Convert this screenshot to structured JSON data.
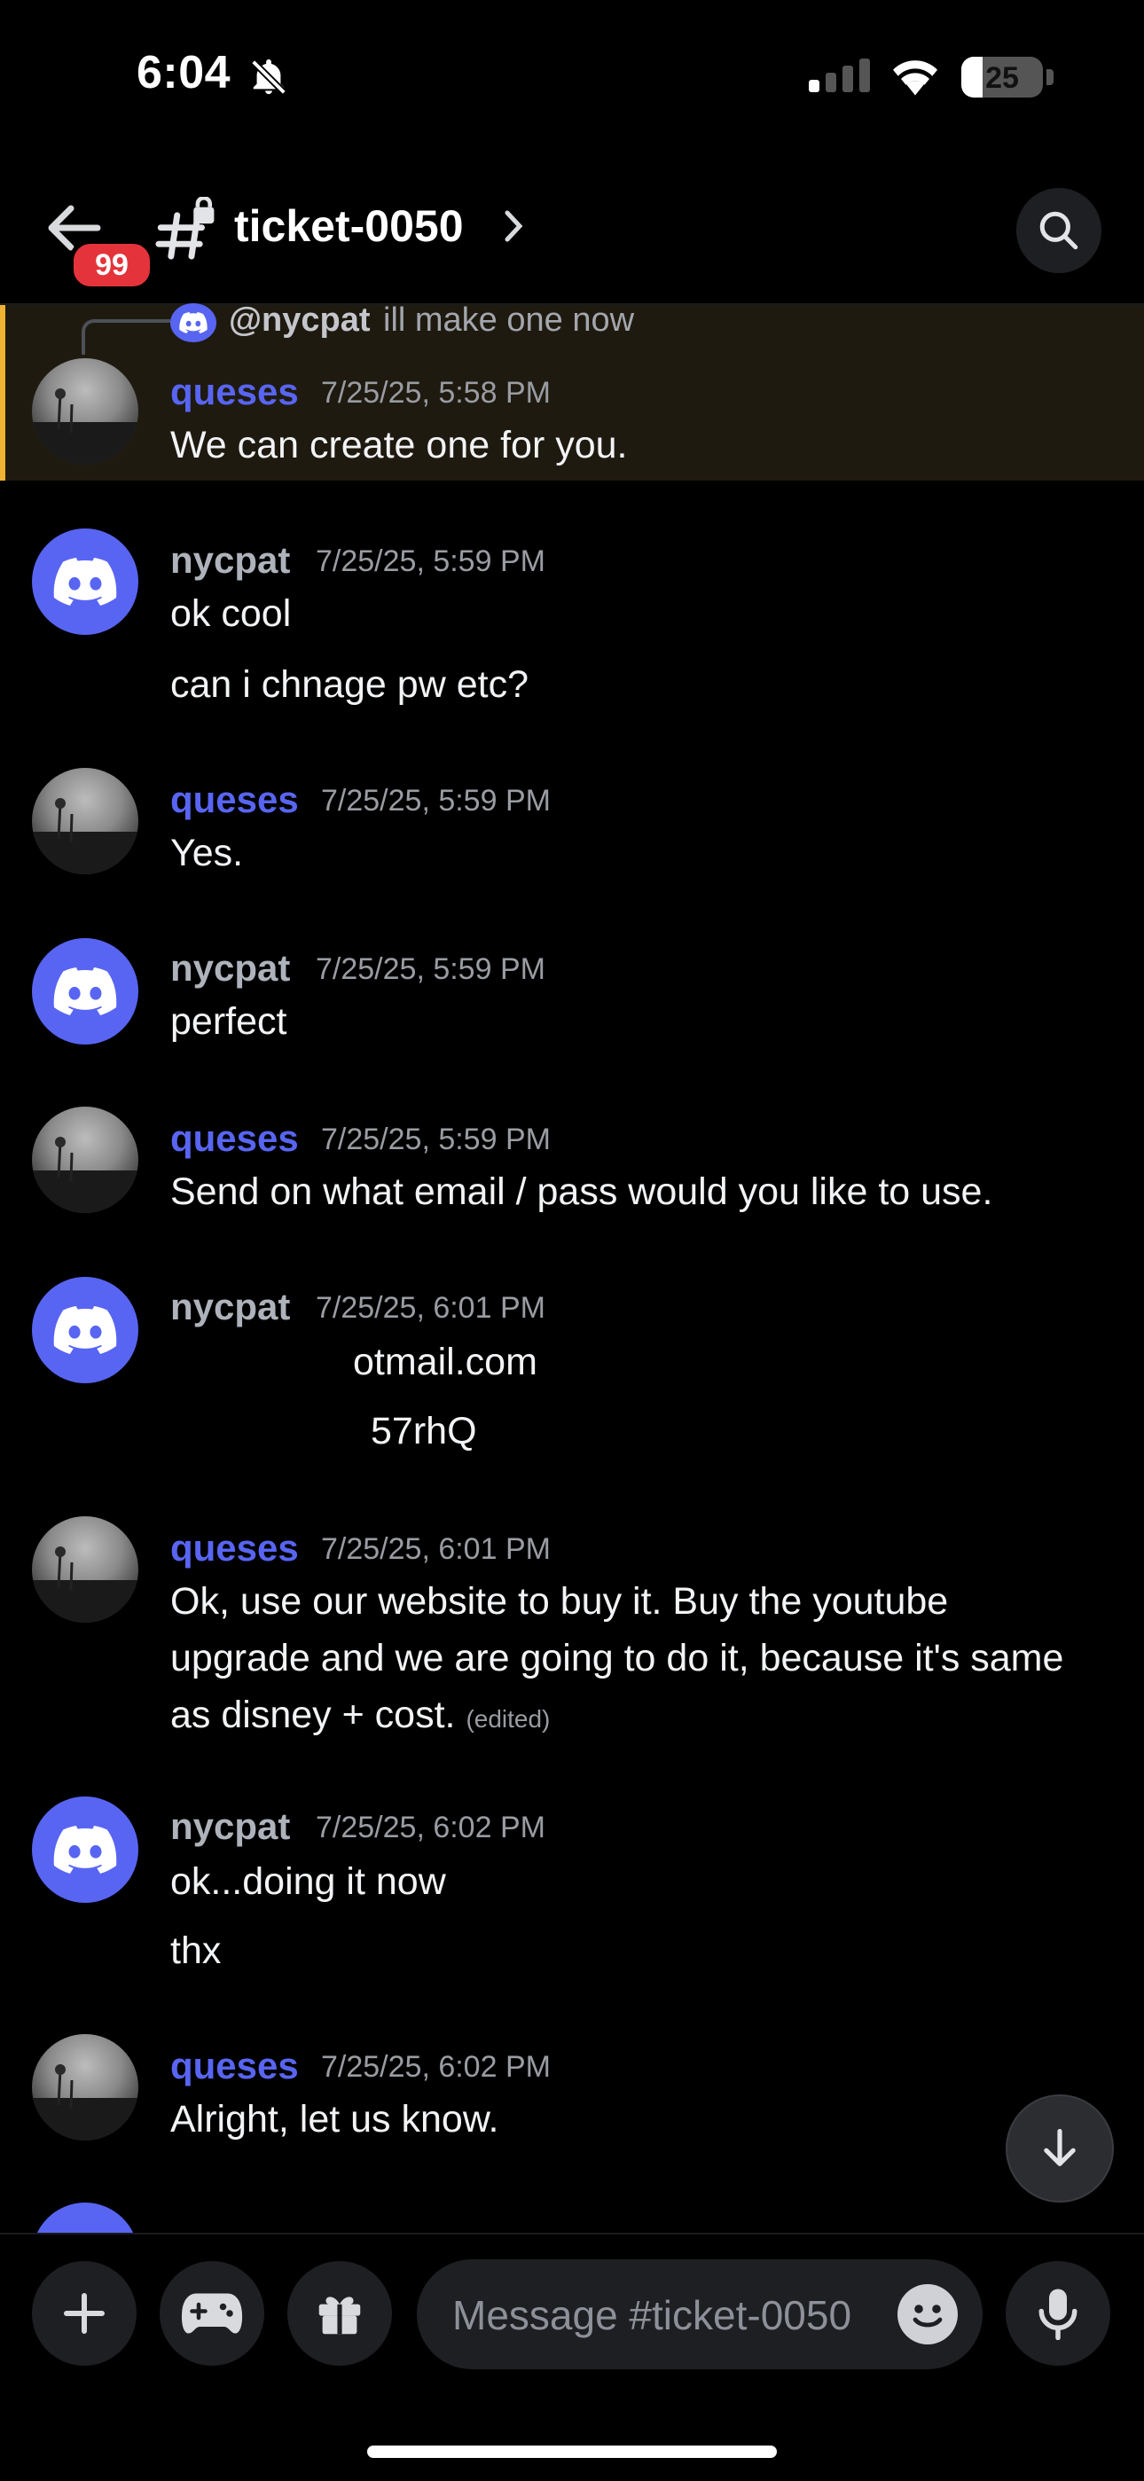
{
  "status_bar": {
    "time": "6:04",
    "battery": "25",
    "icons": [
      "bell-slash-icon",
      "signal-icon",
      "wifi-icon",
      "battery-icon"
    ]
  },
  "header": {
    "unread_badge": "99",
    "channel_name": "ticket-0050",
    "icons": [
      "back-arrow-icon",
      "hash-lock-icon",
      "chevron-right-icon",
      "search-icon"
    ]
  },
  "reply_preview": {
    "user": "@nycpat",
    "text": "ill make one now"
  },
  "messages": [
    {
      "user": "queses",
      "time": "7/25/25, 5:58 PM",
      "lines": [
        "We can create one for you."
      ]
    },
    {
      "user": "nycpat",
      "time": "7/25/25, 5:59 PM",
      "lines": [
        "ok cool",
        "can i chnage pw etc?"
      ]
    },
    {
      "user": "queses",
      "time": "7/25/25, 5:59 PM",
      "lines": [
        "Yes."
      ]
    },
    {
      "user": "nycpat",
      "time": "7/25/25, 5:59 PM",
      "lines": [
        "perfect"
      ]
    },
    {
      "user": "queses",
      "time": "7/25/25, 5:59 PM",
      "lines": [
        "Send on what email / pass would you like to use."
      ]
    },
    {
      "user": "nycpat",
      "time": "7/25/25, 6:01 PM",
      "lines": [
        "otmail.com",
        "57rhQ"
      ]
    },
    {
      "user": "queses",
      "time": "7/25/25, 6:01 PM",
      "lines": [
        "Ok, use our website to buy it. Buy the youtube",
        "upgrade and we are going to do it, because it's same",
        "as disney + cost."
      ],
      "edited": "(edited)"
    },
    {
      "user": "nycpat",
      "time": "7/25/25, 6:02 PM",
      "lines": [
        "ok...doing it now",
        "thx"
      ]
    },
    {
      "user": "queses",
      "time": "7/25/25, 6:02 PM",
      "lines": [
        "Alright, let us know."
      ]
    }
  ],
  "composer": {
    "placeholder": "Message #ticket-0050"
  },
  "colors": {
    "accent": "#5865f2",
    "highlight_bar": "#f0b232",
    "badge": "#e5333b"
  }
}
